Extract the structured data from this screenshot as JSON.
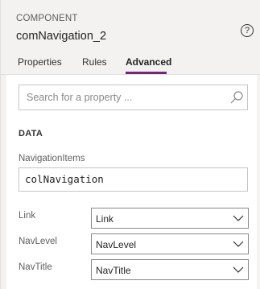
{
  "header": {
    "kind_label": "COMPONENT",
    "component_name": "comNavigation_2",
    "help_symbol": "?"
  },
  "tabs": [
    {
      "label": "Properties",
      "active": false
    },
    {
      "label": "Rules",
      "active": false
    },
    {
      "label": "Advanced",
      "active": true
    }
  ],
  "search": {
    "placeholder": "Search for a property ...",
    "value": ""
  },
  "section": {
    "title": "DATA"
  },
  "navigation_items": {
    "label": "NavigationItems",
    "value": "colNavigation"
  },
  "mappings": [
    {
      "label": "Link",
      "selected": "Link"
    },
    {
      "label": "NavLevel",
      "selected": "NavLevel"
    },
    {
      "label": "NavTitle",
      "selected": "NavTitle"
    }
  ],
  "colors": {
    "accent": "#742774",
    "panel_bg": "#f3f2f1",
    "content_bg": "#ffffff"
  },
  "icons": {
    "help": "help-circle-icon",
    "search": "search-icon",
    "dropdown": "chevron-down-icon"
  }
}
